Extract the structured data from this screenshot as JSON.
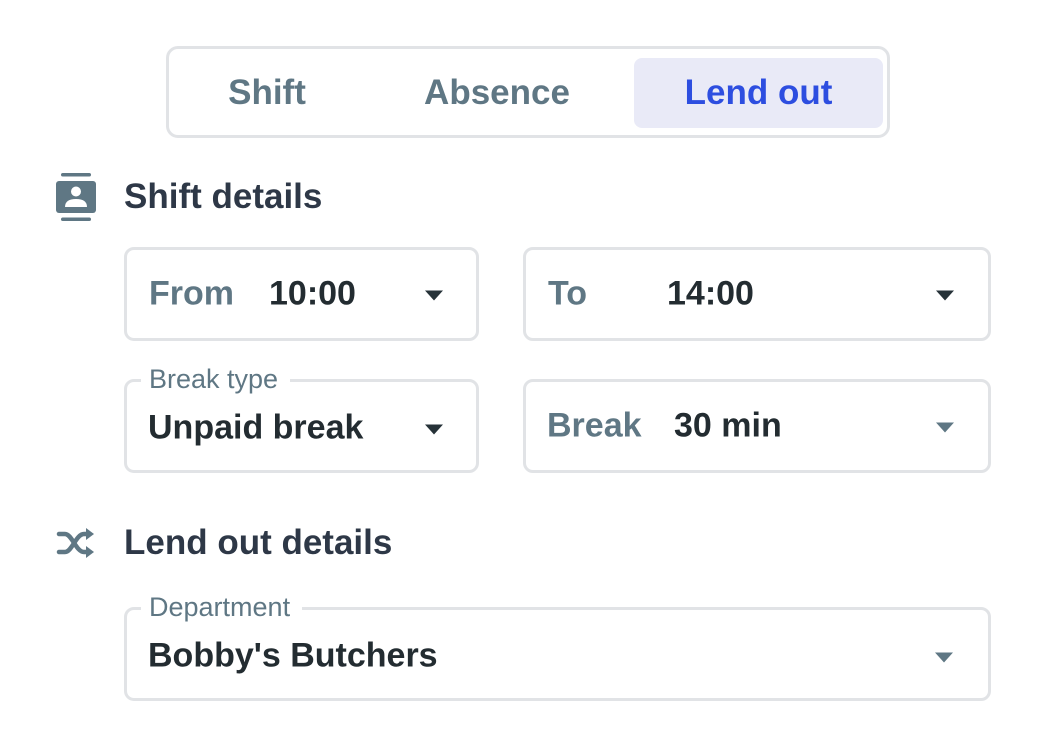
{
  "tabs": [
    {
      "label": "Shift",
      "active": false
    },
    {
      "label": "Absence",
      "active": false
    },
    {
      "label": "Lend out",
      "active": true
    }
  ],
  "colors": {
    "accent": "#2d4ee0",
    "active_tab_bg": "#e9eaf7",
    "muted_text": "#5f7784",
    "heading_text": "#2e3847",
    "value_text": "#232c31",
    "border": "#e1e3e6"
  },
  "shift_details": {
    "title": "Shift details",
    "icon": "contact-badge-icon",
    "from": {
      "label": "From",
      "value": "10:00"
    },
    "to": {
      "label": "To",
      "value": "14:00"
    },
    "break_type": {
      "label": "Break type",
      "value": "Unpaid break"
    },
    "break": {
      "label": "Break",
      "value": "30 min"
    }
  },
  "lend_out_details": {
    "title": "Lend out details",
    "icon": "shuffle-icon",
    "department": {
      "label": "Department",
      "value": "Bobby's Butchers"
    }
  }
}
